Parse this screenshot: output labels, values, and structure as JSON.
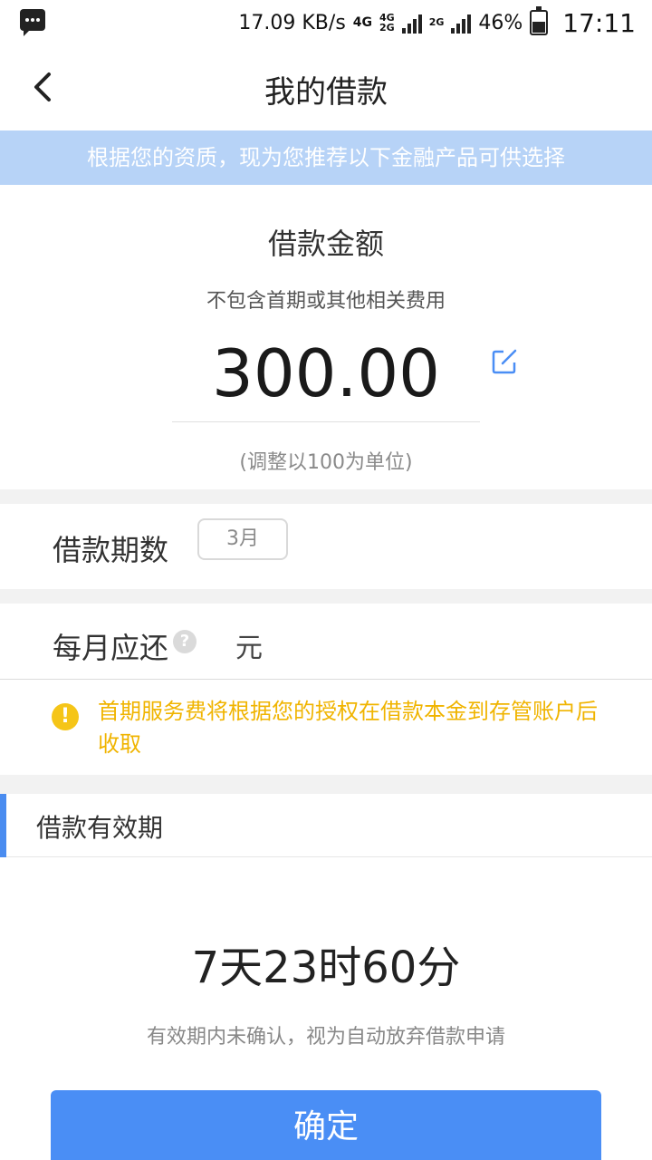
{
  "status_bar": {
    "speed": "17.09 KB/s",
    "net1": "4G",
    "net2_top": "4G",
    "net2_bottom": "2G",
    "net3": "2G",
    "battery": "46%",
    "time": "17:11"
  },
  "header": {
    "title": "我的借款",
    "back_icon": "chevron-left-icon"
  },
  "banner": {
    "text": "根据您的资质，现为您推荐以下金融产品可供选择"
  },
  "amount": {
    "title": "借款金额",
    "subtitle": "不包含首期或其他相关费用",
    "value": "300.00",
    "hint": "(调整以100为单位)",
    "edit_icon": "edit-icon"
  },
  "period": {
    "label": "借款期数",
    "value": "3月"
  },
  "monthly": {
    "label": "每月应还",
    "help_icon": "?",
    "value": "元"
  },
  "warning": {
    "icon": "!",
    "text": "首期服务费将根据您的授权在借款本金到存管账户后收取"
  },
  "validity": {
    "title": "借款有效期",
    "countdown": "7天23时60分",
    "hint": "有效期内未确认，视为自动放弃借款申请"
  },
  "actions": {
    "confirm_label": "确定"
  },
  "colors": {
    "accent": "#4a8ef5",
    "banner": "#b7d3f7",
    "warning": "#f0b400"
  }
}
